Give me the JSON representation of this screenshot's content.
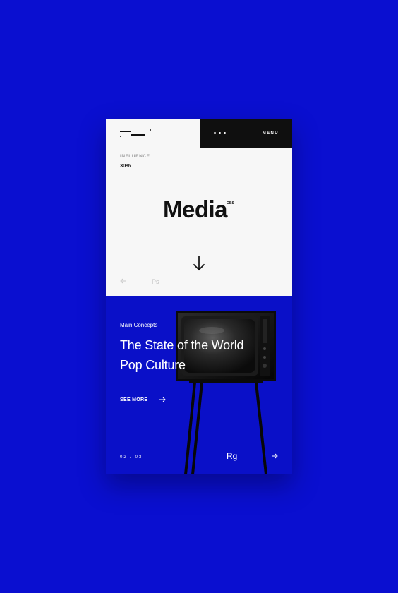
{
  "header": {
    "menu_label": "MENU"
  },
  "intro": {
    "stat_label": "INFLUENCE",
    "stat_value": "30%",
    "title": "Media",
    "superscript": "OBS",
    "tool_label": "Ps"
  },
  "feature": {
    "eyebrow": "Main Concepts",
    "headline_lines": [
      "The State of the World",
      "Pop Culture"
    ],
    "cta_label": "SEE MORE",
    "pagination": "02 / 03",
    "tool_label": "Rg"
  },
  "icons": {
    "logo": "brand-logo-icon",
    "menu": "more-horizontal-icon",
    "down": "arrow-down-icon",
    "left": "arrow-left-icon",
    "right": "arrow-right-icon",
    "tv": "tv-illustration-icon"
  },
  "colors": {
    "background": "#0a0fd0",
    "panel_light": "#f7f7f7",
    "panel_dark": "#0f0f0f",
    "feature_bg": "#0a10c8",
    "text_dark": "#111111",
    "text_light": "#ffffff",
    "muted": "#9c9c9c"
  }
}
